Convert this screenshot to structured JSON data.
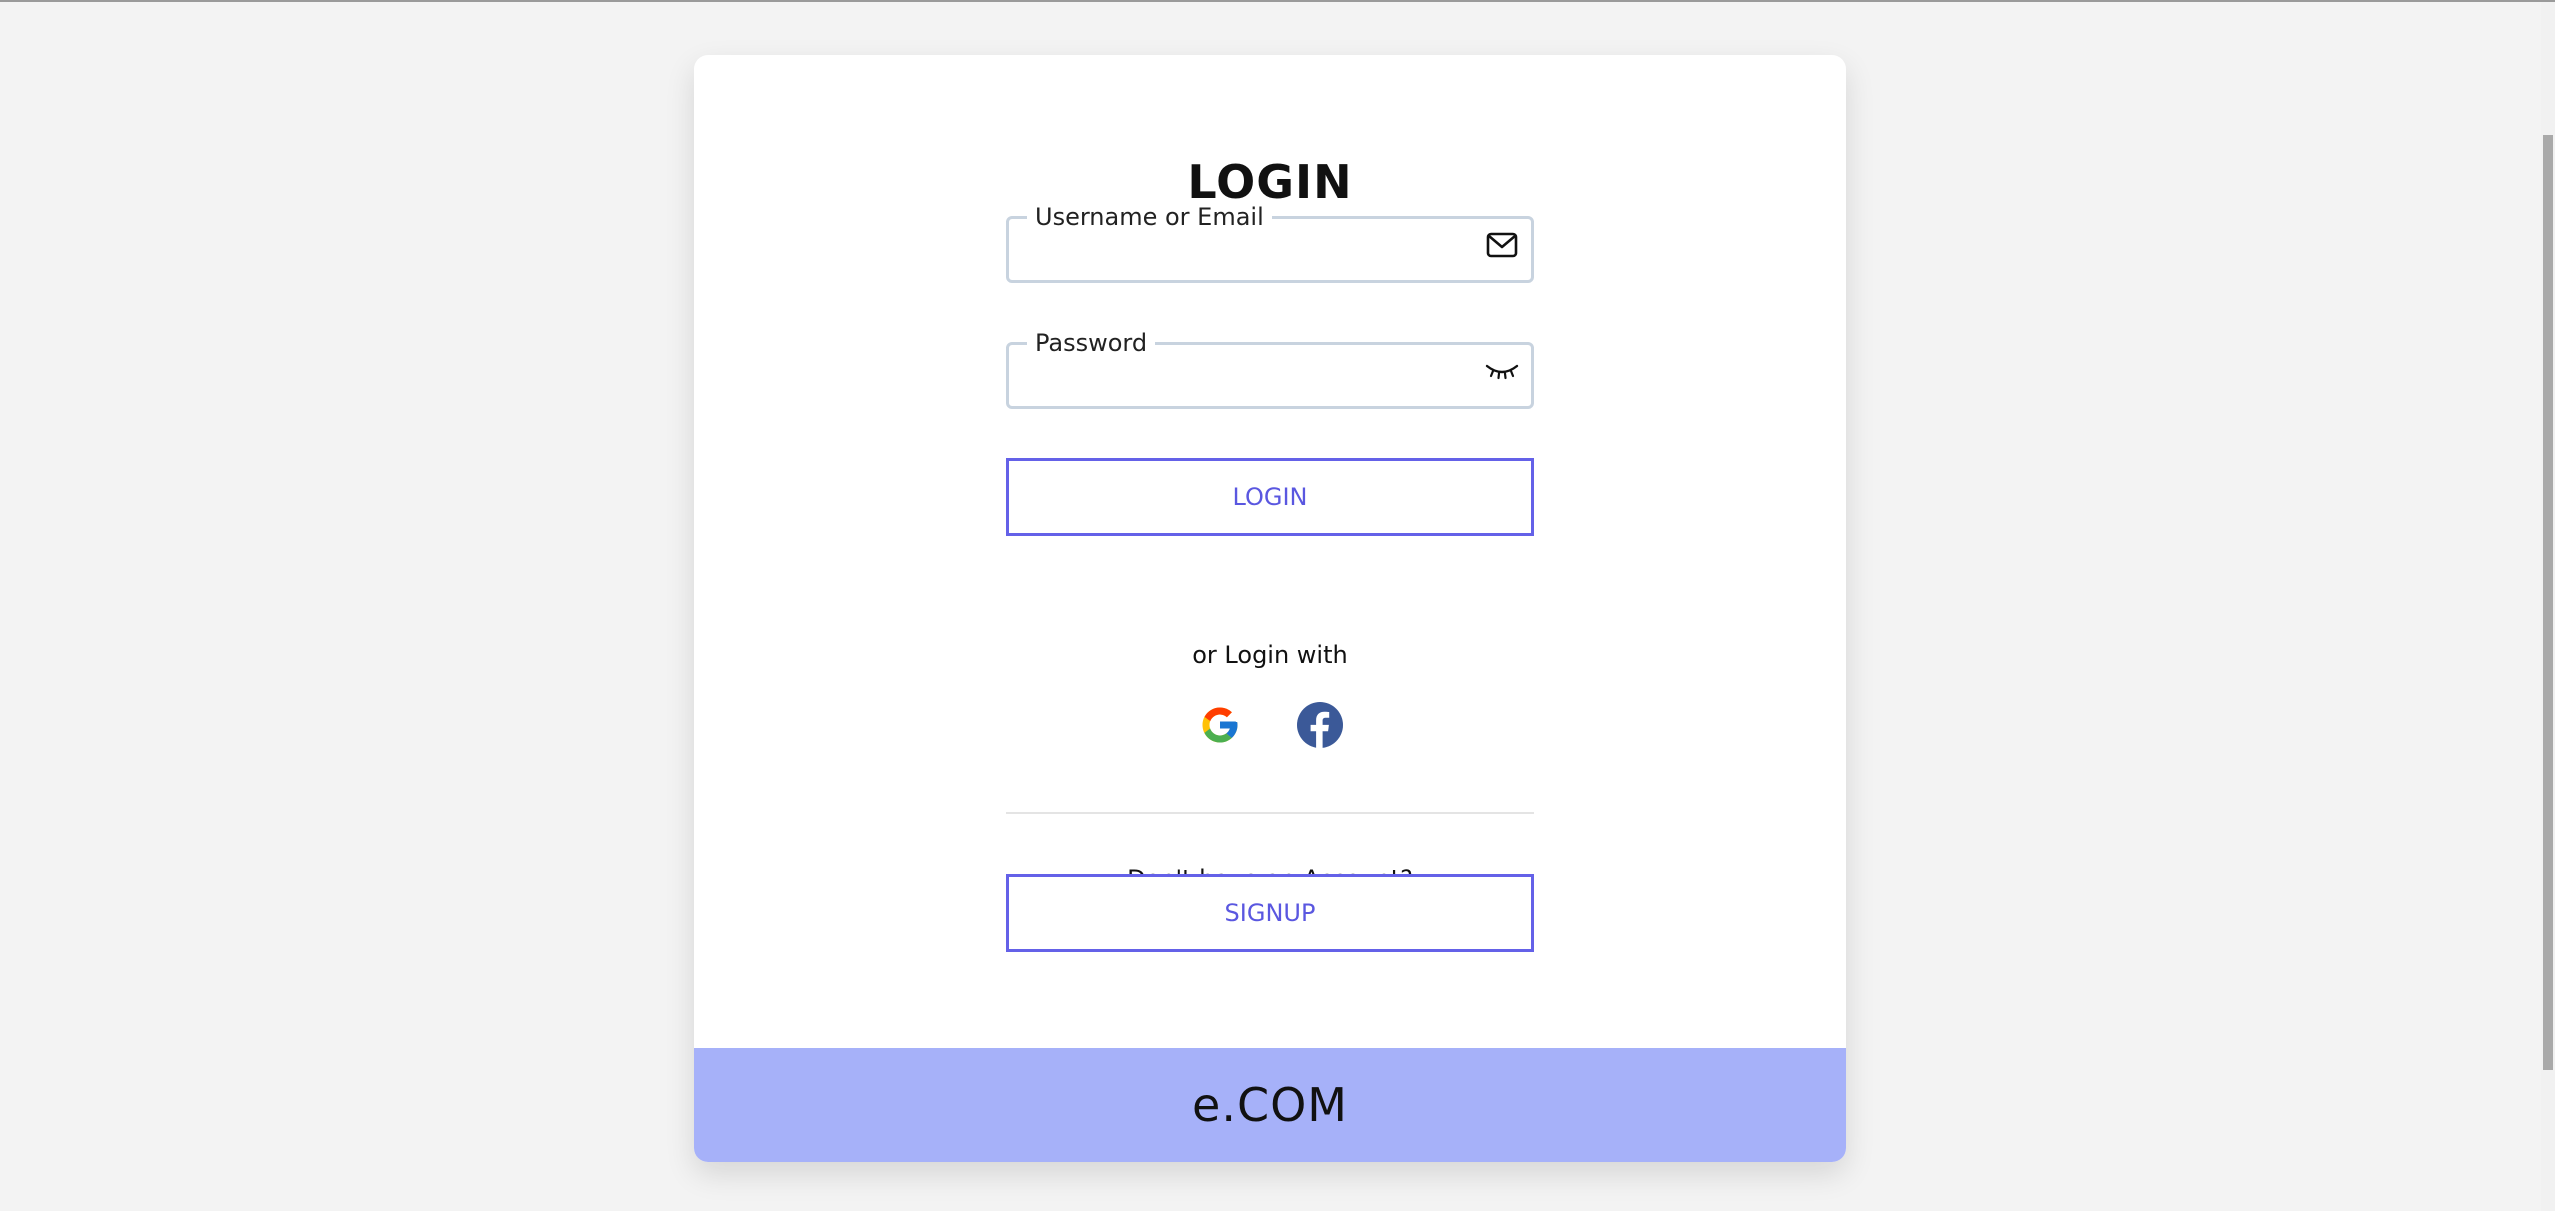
{
  "login": {
    "title": "LOGIN",
    "username_label": "Username or Email",
    "username_value": "",
    "password_label": "Password",
    "password_value": "",
    "login_button": "LOGIN",
    "or_login_with": "or Login with",
    "social": [
      {
        "name": "google",
        "icon": "google-icon"
      },
      {
        "name": "facebook",
        "icon": "facebook-icon",
        "color": "#3b5998"
      }
    ],
    "no_account": "Don't have an Account?",
    "signup_button": "SIGNUP"
  },
  "footer": {
    "brand": "e.COM"
  },
  "colors": {
    "accent": "#6461e8",
    "footer_bg": "#a6b1f9",
    "field_border": "#c8d3df",
    "page_bg": "#f3f3f3"
  }
}
